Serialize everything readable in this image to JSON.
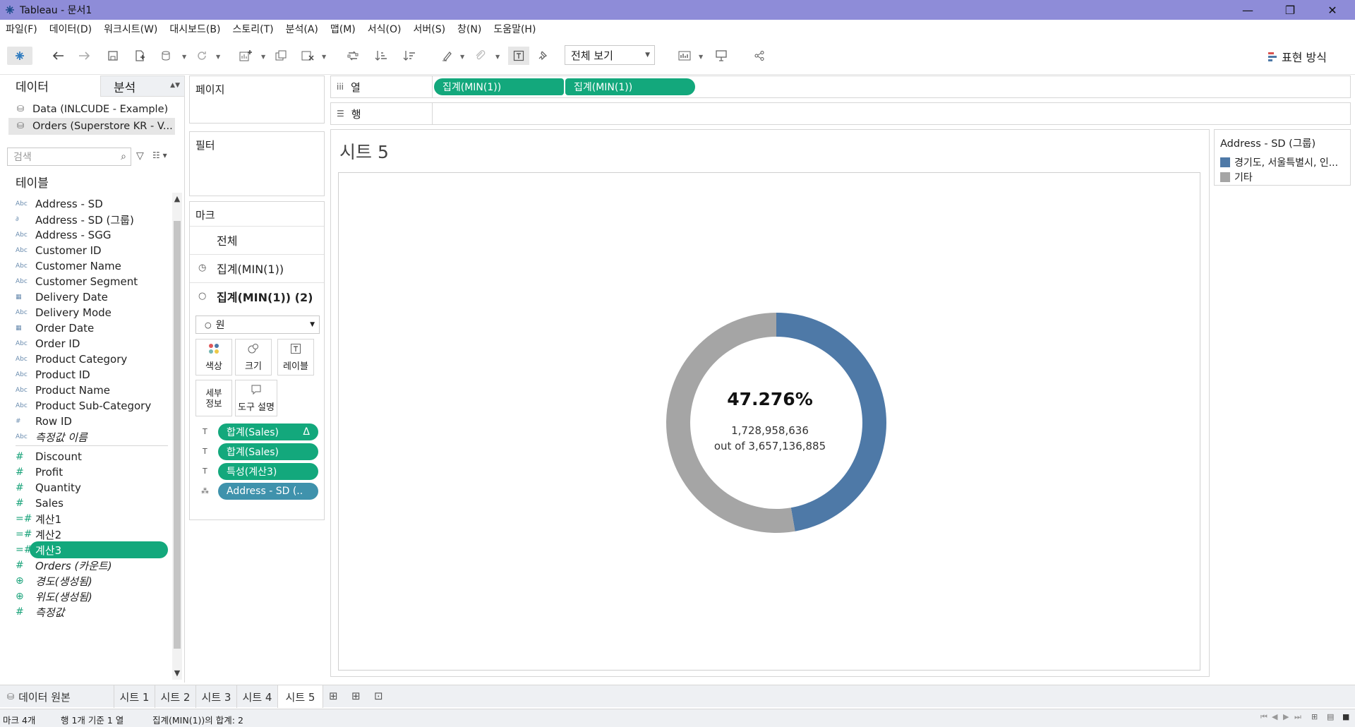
{
  "window": {
    "title": "Tableau - 문서1",
    "minimize": "—",
    "maximize": "❐",
    "close": "✕"
  },
  "menu": [
    "파일(F)",
    "데이터(D)",
    "워크시트(W)",
    "대시보드(B)",
    "스토리(T)",
    "분석(A)",
    "맵(M)",
    "서식(O)",
    "서버(S)",
    "창(N)",
    "도움말(H)"
  ],
  "toolbar": {
    "fit_label": "전체 보기",
    "show_me_label": "표현 방식"
  },
  "data_pane": {
    "tab_data": "데이터",
    "tab_analysis": "분석",
    "datasources": [
      "Data (INLCUDE - Example)",
      "Orders (Superstore KR - V..."
    ],
    "search_placeholder": "검색",
    "tables_title": "테이블",
    "dimensions": [
      {
        "type": "Abc",
        "name": "Address - SD"
      },
      {
        "type": "∂",
        "name": "Address - SD (그룹)"
      },
      {
        "type": "Abc",
        "name": "Address - SGG"
      },
      {
        "type": "Abc",
        "name": "Customer ID"
      },
      {
        "type": "Abc",
        "name": "Customer Name"
      },
      {
        "type": "Abc",
        "name": "Customer Segment"
      },
      {
        "type": "▦",
        "name": "Delivery Date"
      },
      {
        "type": "Abc",
        "name": "Delivery Mode"
      },
      {
        "type": "▦",
        "name": "Order Date"
      },
      {
        "type": "Abc",
        "name": "Order ID"
      },
      {
        "type": "Abc",
        "name": "Product Category"
      },
      {
        "type": "Abc",
        "name": "Product ID"
      },
      {
        "type": "Abc",
        "name": "Product Name"
      },
      {
        "type": "Abc",
        "name": "Product Sub-Category"
      },
      {
        "type": "#",
        "name": "Row ID"
      },
      {
        "type": "Abc",
        "name": "측정값 이름"
      }
    ],
    "measures": [
      {
        "type": "#",
        "name": "Discount"
      },
      {
        "type": "#",
        "name": "Profit"
      },
      {
        "type": "#",
        "name": "Quantity"
      },
      {
        "type": "#",
        "name": "Sales"
      },
      {
        "type": "=#",
        "name": "계산1"
      },
      {
        "type": "=#",
        "name": "계산2"
      },
      {
        "type": "=#",
        "name": "계산3"
      },
      {
        "type": "#",
        "name": "Orders (카운트)"
      },
      {
        "type": "⊕",
        "name": "경도(생성됨)"
      },
      {
        "type": "⊕",
        "name": "위도(생성됨)"
      },
      {
        "type": "#",
        "name": "측정값"
      }
    ]
  },
  "shelves": {
    "pages": "페이지",
    "filters": "필터",
    "columns_label": "열",
    "rows_label": "행",
    "columns_pills": [
      "집계(MIN(1))",
      "집계(MIN(1))"
    ]
  },
  "marks": {
    "title": "마크",
    "all": "전체",
    "layer1": "집계(MIN(1))",
    "layer2": "집계(MIN(1)) (2)",
    "mark_type": "원",
    "buttons": {
      "color": "색상",
      "size": "크기",
      "label": "레이블",
      "detail": "세부\n정보",
      "tooltip": "도구 설명"
    },
    "pills": [
      "합계(Sales)",
      "합계(Sales)",
      "특성(계산3)",
      "Address - SD (.."
    ],
    "delta": "Δ"
  },
  "sheet": {
    "title": "시트 5",
    "percent": "47.276%",
    "numerator": "1,728,958,636",
    "out_of": "out of  3,657,136,885"
  },
  "chart_data": {
    "type": "pie",
    "categories": [
      "경기도, 서울특별시, 인...",
      "기타"
    ],
    "values": [
      1728958636,
      1928178249
    ],
    "colors": [
      "#4e79a7",
      "#a5a5a5"
    ],
    "center_label": "47.276%"
  },
  "legend": {
    "title": "Address - SD (그룹)",
    "items": [
      {
        "label": "경기도, 서울특별시, 인...",
        "color": "#4e79a7"
      },
      {
        "label": "기타",
        "color": "#a5a5a5"
      }
    ]
  },
  "sheet_tabs": {
    "data_source": "데이터 원본",
    "tabs": [
      "시트 1",
      "시트 2",
      "시트 3",
      "시트 4",
      "시트 5"
    ]
  },
  "status": {
    "marks": "마크 4개",
    "rows_cols": "행 1개 기준 1 열",
    "sum": "집계(MIN(1))의 합계: 2"
  }
}
